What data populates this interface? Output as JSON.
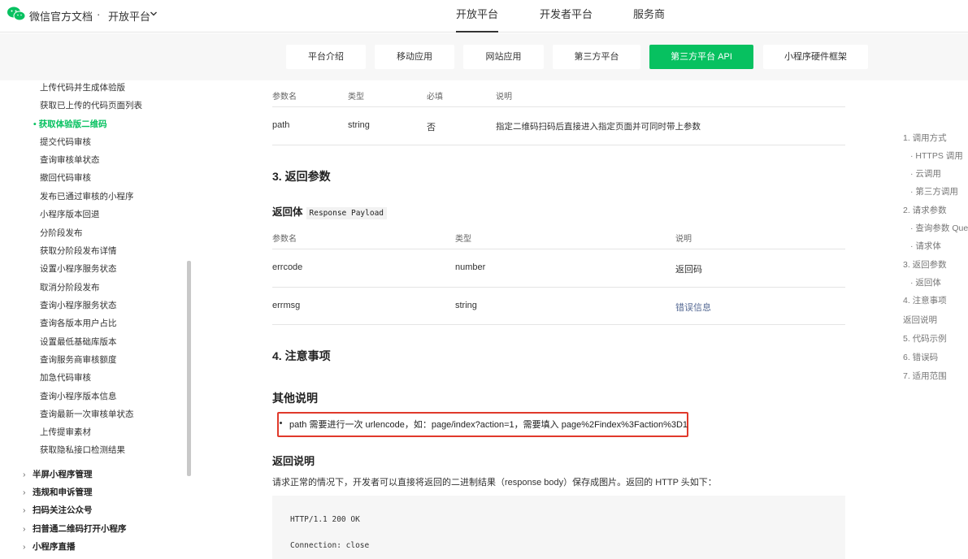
{
  "header": {
    "brand": "微信官方文档",
    "dot": "·",
    "platform": "开放平台",
    "nav": [
      "开放平台",
      "开发者平台",
      "服务商"
    ]
  },
  "subnav": [
    "平台介绍",
    "移动应用",
    "网站应用",
    "第三方平台",
    "第三方平台 API",
    "小程序硬件框架"
  ],
  "sidebar": {
    "items": [
      "上传代码并生成体验版",
      "获取已上传的代码页面列表",
      "获取体验版二维码",
      "提交代码审核",
      "查询审核单状态",
      "撤回代码审核",
      "发布已通过审核的小程序",
      "小程序版本回退",
      "分阶段发布",
      "获取分阶段发布详情",
      "设置小程序服务状态",
      "取消分阶段发布",
      "查询小程序服务状态",
      "查询各版本用户占比",
      "设置最低基础库版本",
      "查询服务商审核额度",
      "加急代码审核",
      "查询小程序版本信息",
      "查询最新一次审核单状态",
      "上传提审素材",
      "获取隐私接口检测结果"
    ],
    "groups": [
      "半屏小程序管理",
      "违规和申诉管理",
      "扫码关注公众号",
      "扫普通二维码打开小程序",
      "小程序直播"
    ]
  },
  "query_table": {
    "headers": [
      "参数名",
      "类型",
      "必填",
      "说明"
    ],
    "rows": [
      [
        "path",
        "string",
        "否",
        "指定二维码扫码后直接进入指定页面并可同时带上参数"
      ]
    ]
  },
  "section3": "3. 返回参数",
  "payload_title": "返回体",
  "payload_code": "Response Payload",
  "payload_table": {
    "headers": [
      "参数名",
      "类型",
      "说明"
    ],
    "rows": [
      [
        "errcode",
        "number",
        "返回码"
      ],
      [
        "errmsg",
        "string",
        "错误信息"
      ]
    ]
  },
  "section4": "4. 注意事项",
  "other_title": "其他说明",
  "note": "path 需要进行一次 urlencode，如：page/index?action=1，需要填入 page%2Findex%3Faction%3D1",
  "return_title": "返回说明",
  "return_para": "请求正常的情况下，开发者可以直接将返回的二进制结果（response body）保存成图片。返回的 HTTP 头如下：",
  "code_lines": [
    "HTTP/1.1 200 OK",
    "Connection: close"
  ],
  "toc": [
    "1. 调用方式",
    "· HTTPS 调用",
    "· 云调用",
    "· 第三方调用",
    "2. 请求参数",
    "· 查询参数 Que",
    "· 请求体",
    "3. 返回参数",
    "· 返回体",
    "4. 注意事项",
    "返回说明",
    "5. 代码示例",
    "6. 错误码",
    "7. 适用范围"
  ],
  "colors": {
    "accent": "#07c160",
    "link": "#576b95",
    "highlight_border": "#e0392b"
  }
}
